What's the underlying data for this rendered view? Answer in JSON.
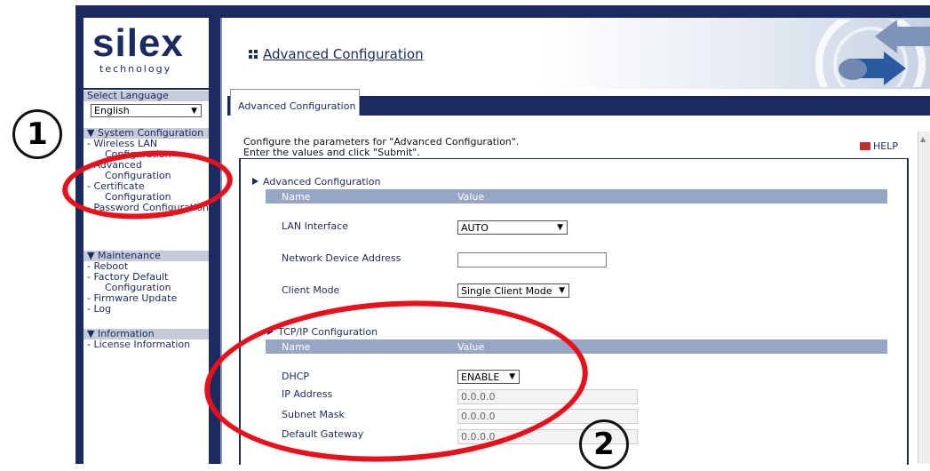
{
  "brand": {
    "logo": "silex",
    "subtitle": "technology"
  },
  "sidebar": {
    "language_header": "Select Language",
    "language_value": "English",
    "sections": [
      {
        "title": "▼ System Configuration",
        "items": [
          "- Wireless LAN Configuration",
          "- Advanced Configuration",
          "- Certificate Configuration",
          "- Password Configuration"
        ]
      },
      {
        "title": "▼ Maintenance",
        "items": [
          "- Reboot",
          "- Factory Default Configuration",
          "- Firmware Update",
          "- Log"
        ]
      },
      {
        "title": "▼ Information",
        "items": [
          "- License Information"
        ]
      }
    ]
  },
  "header": {
    "title": "Advanced Configuration"
  },
  "tab": {
    "label": "Advanced Configuration"
  },
  "intro": {
    "line1": "Configure the parameters for \"Advanced Configuration\".",
    "line2": "Enter the values and click \"Submit\"."
  },
  "help": {
    "label": "HELP"
  },
  "advanced": {
    "title": "Advanced Configuration",
    "col_name": "Name",
    "col_value": "Value",
    "rows": {
      "lan_interface": {
        "label": "LAN Interface",
        "value": "AUTO"
      },
      "network_device_address": {
        "label": "Network Device Address",
        "value": ""
      },
      "client_mode": {
        "label": "Client Mode",
        "value": "Single Client Mode"
      }
    }
  },
  "tcpip": {
    "title": "TCP/IP Configuration",
    "col_name": "Name",
    "col_value": "Value",
    "rows": {
      "dhcp": {
        "label": "DHCP",
        "value": "ENABLE"
      },
      "ip": {
        "label": "IP Address",
        "value": "0.0.0.0"
      },
      "subnet": {
        "label": "Subnet Mask",
        "value": "0.0.0.0"
      },
      "gateway": {
        "label": "Default Gateway",
        "value": "0.0.0.0"
      }
    }
  },
  "annotations": {
    "marker1": "1",
    "marker2": "2",
    "ring_color": "#e8101a"
  }
}
